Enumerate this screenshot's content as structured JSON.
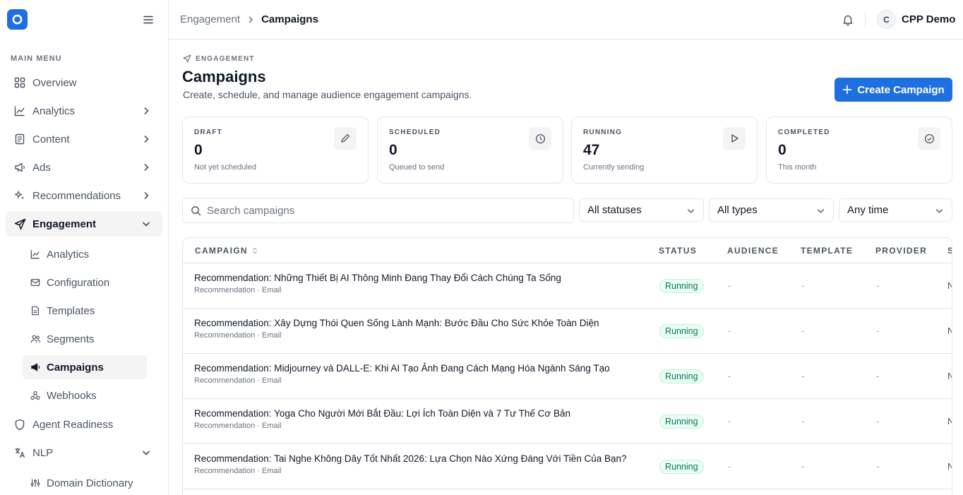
{
  "sidebar": {
    "section_label": "MAIN MENU",
    "items": {
      "overview": "Overview",
      "analytics": "Analytics",
      "content": "Content",
      "ads": "Ads",
      "recommendations": "Recommendations",
      "engagement": "Engagement",
      "agent_readiness": "Agent Readiness",
      "nlp": "NLP"
    },
    "engagement_sub": {
      "analytics": "Analytics",
      "configuration": "Configuration",
      "templates": "Templates",
      "segments": "Segments",
      "campaigns": "Campaigns",
      "webhooks": "Webhooks"
    },
    "nlp_sub": {
      "domain_dictionary": "Domain Dictionary"
    }
  },
  "topbar": {
    "breadcrumb_parent": "Engagement",
    "breadcrumb_current": "Campaigns",
    "avatar_initial": "C",
    "username": "CPP Demo"
  },
  "header": {
    "eyebrow": "ENGAGEMENT",
    "title": "Campaigns",
    "subtitle": "Create, schedule, and manage audience engagement campaigns.",
    "create_label": "Create Campaign"
  },
  "stats": [
    {
      "label": "DRAFT",
      "value": "0",
      "note": "Not yet scheduled",
      "icon": "pencil-icon"
    },
    {
      "label": "SCHEDULED",
      "value": "0",
      "note": "Queued to send",
      "icon": "clock-icon"
    },
    {
      "label": "RUNNING",
      "value": "47",
      "note": "Currently sending",
      "icon": "play-icon"
    },
    {
      "label": "COMPLETED",
      "value": "0",
      "note": "This month",
      "icon": "check-circle-icon"
    }
  ],
  "filters": {
    "search_placeholder": "Search campaigns",
    "status": "All statuses",
    "type": "All types",
    "time": "Any time"
  },
  "table": {
    "columns": {
      "campaign": "CAMPAIGN",
      "status": "STATUS",
      "audience": "AUDIENCE",
      "template": "TEMPLATE",
      "provider": "PROVIDER",
      "truncated": "S"
    },
    "rows": [
      {
        "name": "Recommendation: Những Thiết Bị AI Thông Minh Đang Thay Đổi Cách Chúng Ta Sống",
        "meta": "Recommendation · Email",
        "status": "Running",
        "audience": "-",
        "template": "-",
        "provider": "-",
        "truncated": "N"
      },
      {
        "name": "Recommendation: Xây Dựng Thói Quen Sống Lành Mạnh: Bước Đầu Cho Sức Khỏe Toàn Diện",
        "meta": "Recommendation · Email",
        "status": "Running",
        "audience": "-",
        "template": "-",
        "provider": "-",
        "truncated": "N"
      },
      {
        "name": "Recommendation: Midjourney và DALL-E: Khi AI Tạo Ảnh Đang Cách Mạng Hóa Ngành Sáng Tạo",
        "meta": "Recommendation · Email",
        "status": "Running",
        "audience": "-",
        "template": "-",
        "provider": "-",
        "truncated": "N"
      },
      {
        "name": "Recommendation: Yoga Cho Người Mới Bắt Đầu: Lợi Ích Toàn Diện và 7 Tư Thế Cơ Bản",
        "meta": "Recommendation · Email",
        "status": "Running",
        "audience": "-",
        "template": "-",
        "provider": "-",
        "truncated": "N"
      },
      {
        "name": "Recommendation: Tai Nghe Không Dây Tốt Nhất 2026: Lựa Chọn Nào Xứng Đáng Với Tiền Của Bạn?",
        "meta": "Recommendation · Email",
        "status": "Running",
        "audience": "-",
        "template": "-",
        "provider": "-",
        "truncated": "N"
      }
    ]
  },
  "colors": {
    "accent": "#1e6fe0",
    "running_bg": "#ecfdf5",
    "running_text": "#047857"
  }
}
